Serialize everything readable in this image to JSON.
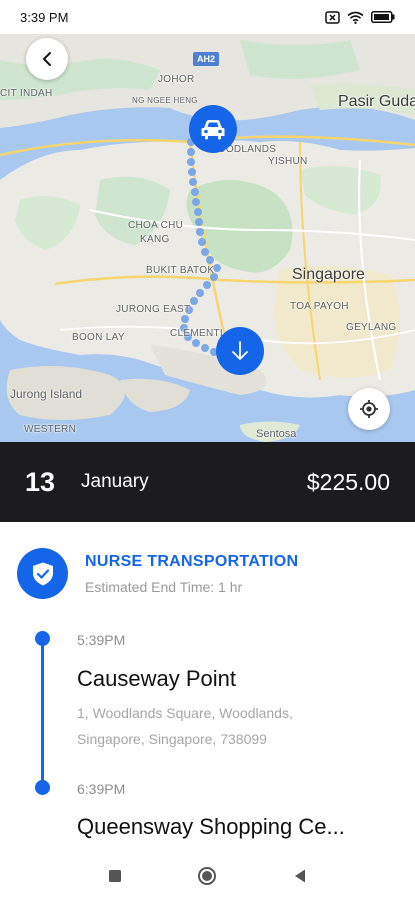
{
  "status_bar": {
    "time": "3:39 PM",
    "icons": [
      "close-box-icon",
      "wifi-icon",
      "battery-icon"
    ]
  },
  "map": {
    "labels": {
      "johor": "JOHOR",
      "indah": "CIT INDAH",
      "ng_hang": "NG NGEE HENG",
      "woodlands": "WOODLANDS",
      "yishun": "YISHUN",
      "pasir": "Pasir Guda",
      "choa": "CHOA CHU",
      "kang": "KANG",
      "bukit": "BUKIT BATOK",
      "singapore": "Singapore",
      "toa": "TOA PAYOH",
      "jurong_east": "JURONG EAST",
      "boon_lay": "BOON LAY",
      "clementi": "CLEMENTI",
      "geylang": "GEYLANG",
      "jurong_island": "Jurong Island",
      "western": "WESTERN",
      "sentosa": "Sentosa",
      "hw": "AH2"
    },
    "route_color": "#7ba7e6",
    "pin_color": "#1565e8"
  },
  "booking": {
    "day": "13",
    "month": "January",
    "price": "$225.00"
  },
  "service": {
    "title": "NURSE TRANSPORTATION",
    "subtitle": "Estimated End Time: 1 hr"
  },
  "stops": [
    {
      "time": "5:39PM",
      "name": "Causeway Point",
      "address": "1, Woodlands Square, Woodlands, Singapore, Singapore, 738099"
    },
    {
      "time": "6:39PM",
      "name": "Queensway Shopping Ce..."
    }
  ],
  "accent": "#1565e8"
}
